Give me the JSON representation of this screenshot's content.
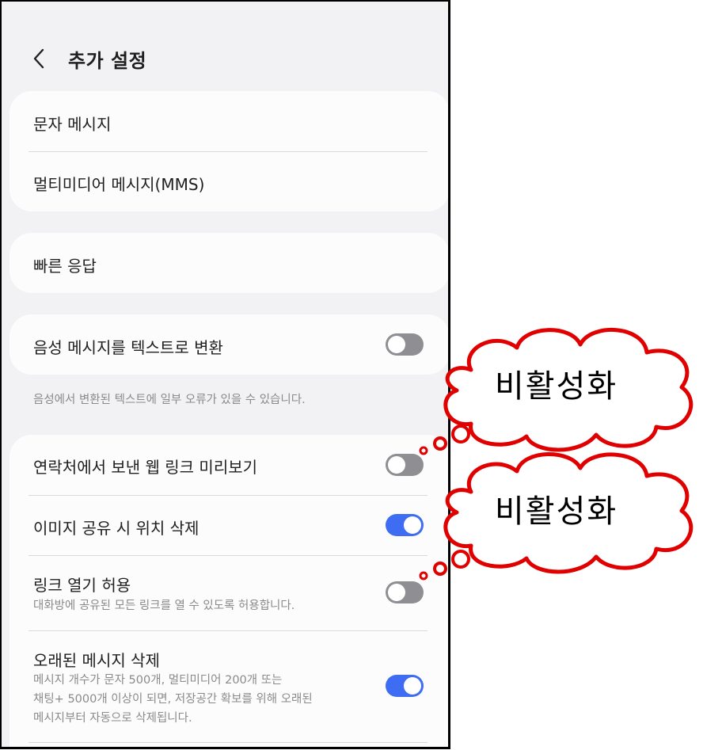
{
  "header": {
    "title": "추가 설정"
  },
  "groups": {
    "messages": {
      "sms": "문자 메시지",
      "mms": "멀티미디어 메시지(MMS)"
    },
    "quick": {
      "quick_reply": "빠른 응답"
    },
    "voice": {
      "label": "음성 메시지를 텍스트로 변환",
      "enabled": false,
      "note": "음성에서 변환된 텍스트에 일부 오류가 있을 수 있습니다."
    },
    "privacy": {
      "items": [
        {
          "label": "연락처에서 보낸 웹 링크 미리보기",
          "enabled": false
        },
        {
          "label": "이미지 공유 시 위치 삭제",
          "enabled": true
        },
        {
          "label": "링크 열기 허용",
          "sub": "대화방에 공유된 모든 링크를 열 수 있도록 허용합니다.",
          "enabled": false
        },
        {
          "label": "오래된 메시지 삭제",
          "sub1": "메시지 개수가 문자 500개, 멀티미디어 200개 또는",
          "sub2": "채팅+ 5000개 이상이 되면, 저장공간 확보를 위해 오래된",
          "sub3": "메시지부터 자동으로 삭제됩니다.",
          "enabled": true
        }
      ]
    }
  },
  "annotations": [
    {
      "text": "비활성화"
    },
    {
      "text": "비활성화"
    }
  ],
  "colors": {
    "toggle_on": "#3e6df3",
    "toggle_off": "#8f8f93",
    "callout": "#e00000"
  }
}
